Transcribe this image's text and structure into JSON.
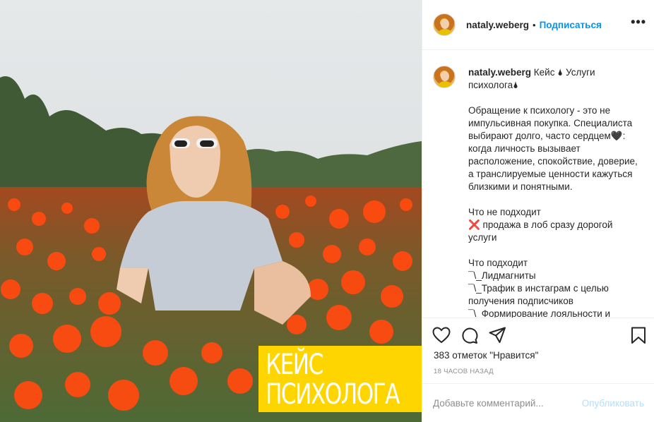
{
  "post": {
    "username": "nataly.weberg",
    "dot": "•",
    "follow_label": "Подписаться",
    "more_label": "•••",
    "badge_text": "Кейс\nпсихолога",
    "caption": {
      "username": "nataly.weberg",
      "title": " Кейс 🌢 Услуги психолога🌢",
      "paragraphs": [
        "Обращение к психологу - это не импульсивная покупка. Специалиста выбирают долго, часто сердцем🖤: когда личность вызывает расположение, спокойствие, доверие, а транслируемые ценности кажуться близкими и понятными.",
        "Что не подходит\n❌ продажа в лоб сразу дорогой услуги",
        "Что подходит\n¯\\_Лидмагниты\n¯\\_Трафик в инстаграм с целью получения подписчиков\n¯\\_Формирование лояльности и"
      ]
    },
    "likes": "383 отметок \"Нравится\"",
    "time_ago": "18 ЧАСОВ НАЗАД",
    "comment_placeholder": "Добавьте комментарий...",
    "publish_label": "Опубликовать",
    "icons": [
      "heart-icon",
      "comment-icon",
      "share-icon",
      "bookmark-icon"
    ],
    "colors": {
      "accent": "#0095f6",
      "badge": "#ffd500",
      "publish_disabled": "#b2dffc"
    }
  }
}
